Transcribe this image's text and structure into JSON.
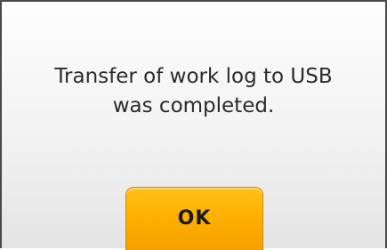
{
  "dialog": {
    "message_line1": "Transfer of work log to USB",
    "message_line2": "was completed.",
    "ok_label": "OK"
  },
  "colors": {
    "button_accent": "#ffb000",
    "border": "#4a4a4a",
    "text": "#2b2b2b"
  }
}
